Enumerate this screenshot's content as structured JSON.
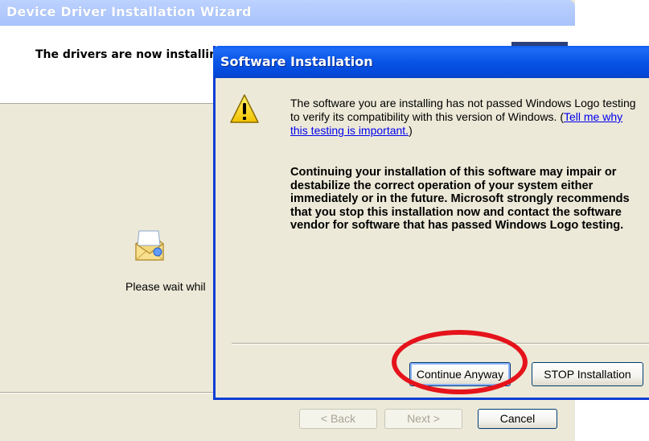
{
  "wizard": {
    "title": "Device Driver Installation Wizard",
    "heading": "The drivers are now installir",
    "wait_text": "Please wait whil",
    "buttons": {
      "back": "< Back",
      "next": "Next >",
      "cancel": "Cancel"
    }
  },
  "dialog": {
    "title": "Software Installation",
    "message_text": "The software you are installing has not passed Windows Logo testing to verify its compatibility with this version of Windows. (",
    "message_link": "Tell me why this testing is important.",
    "message_close": ")",
    "warning": "Continuing your installation of this software may impair or destabilize the correct operation of your system either immediately or in the future. Microsoft strongly recommends that you stop this installation now and contact the software vendor for software that has passed Windows Logo testing.",
    "buttons": {
      "continue": "Continue Anyway",
      "stop": "STOP Installation"
    }
  },
  "icons": {
    "warning": "warning-triangle-icon",
    "envelope": "open-envelope-icon"
  },
  "colors": {
    "titlebar_active": "#0854e6",
    "titlebar_inactive": "#a8c2fb",
    "highlight": "#e5131b",
    "dialog_bg": "#ece9d8"
  }
}
